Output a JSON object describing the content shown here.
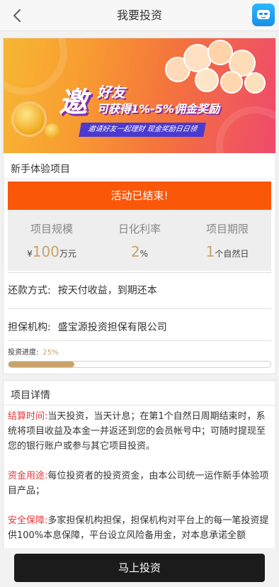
{
  "header": {
    "title": "我要投资",
    "back_icon": "chevron-left-icon",
    "service_icon": "customer-service-icon"
  },
  "banner": {
    "big_char": "邀",
    "headline": "好友",
    "subline": "可获得1%-5%佣金奖励",
    "ribbon": "邀请好友一起理财 现金奖励日日领"
  },
  "project": {
    "title": "新手体验项目",
    "status": "活动已结束!",
    "accent": "#fb5709",
    "gold": "#c9a26a",
    "stats": [
      {
        "label": "项目规模",
        "prefix": "¥",
        "value": "100",
        "unit": "万元"
      },
      {
        "label": "日化利率",
        "prefix": "",
        "value": "2",
        "unit": "%"
      },
      {
        "label": "项目期限",
        "prefix": "",
        "value": "1",
        "unit": "个自然日"
      }
    ],
    "repay_label": "还款方式:",
    "repay_value": "按天付收益，到期还本",
    "guarantor_label": "担保机构:",
    "guarantor_value": "盛宝源投资担保有限公司",
    "progress_label": "投资进度:",
    "progress_text": "25%",
    "progress_value": 0.25
  },
  "detail": {
    "title": "项目详情",
    "sections": [
      {
        "tag": "结算时间:",
        "text": "当天投资，当天计息；在第1个自然日周期结束时，系统将项目收益及本金一并返还到您的会员帐号中；可随时提现至您的银行账户或参与其它项目投资。"
      },
      {
        "tag": "资金用途:",
        "text": "每位投资者的投资资金，由本公司统一运作新手体验项目产品；"
      },
      {
        "tag": "安全保障:",
        "text": "多家担保机构担保，担保机构对平台上的每一笔投资提供100%本息保障，平台设立风险备用金，对本息承诺全额"
      }
    ]
  },
  "footer": {
    "button": "马上投资"
  }
}
